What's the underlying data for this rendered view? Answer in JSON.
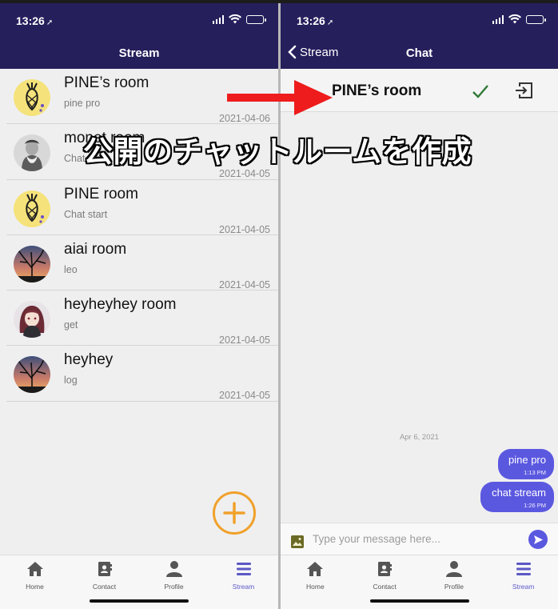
{
  "status_bar": {
    "time": "13:26"
  },
  "left_screen": {
    "header_title": "Stream",
    "rooms": [
      {
        "name": "PINE’s room",
        "subtitle": "pine pro",
        "date": "2021-04-06",
        "avatar": "pineapple-avatar"
      },
      {
        "name": "monet room",
        "subtitle": "Chat start",
        "date": "2021-04-05",
        "avatar": "monet-avatar"
      },
      {
        "name": "PINE room",
        "subtitle": "Chat start",
        "date": "2021-04-05",
        "avatar": "pineapple-avatar"
      },
      {
        "name": "aiai room",
        "subtitle": "leo",
        "date": "2021-04-05",
        "avatar": "sunset-tree-avatar"
      },
      {
        "name": "heyheyhey room",
        "subtitle": "get",
        "date": "2021-04-05",
        "avatar": "anime-girl-avatar"
      },
      {
        "name": "heyhey",
        "subtitle": "log",
        "date": "2021-04-05",
        "avatar": "sunset-tree-avatar"
      }
    ],
    "fab_icon": "plus-icon"
  },
  "right_screen": {
    "back_label": "Stream",
    "header_title": "Chat",
    "room_title": "PINE’s room",
    "day_label": "Apr 6, 2021",
    "messages": [
      {
        "text": "pine pro",
        "time": "1:13 PM"
      },
      {
        "text": "chat stream",
        "time": "1:26 PM"
      }
    ],
    "input_placeholder": "Type your message here..."
  },
  "tabs": [
    {
      "label": "Home",
      "icon": "home-icon"
    },
    {
      "label": "Contact",
      "icon": "contact-icon"
    },
    {
      "label": "Profile",
      "icon": "profile-icon"
    },
    {
      "label": "Stream",
      "icon": "stream-icon"
    }
  ],
  "active_tab": "Stream",
  "annotation": {
    "caption": "公開のチャットルームを作成"
  },
  "colors": {
    "header": "#251f5c",
    "accent": "#5b58e0",
    "fab": "#f0a12a",
    "arrow": "#ee1c1c"
  }
}
